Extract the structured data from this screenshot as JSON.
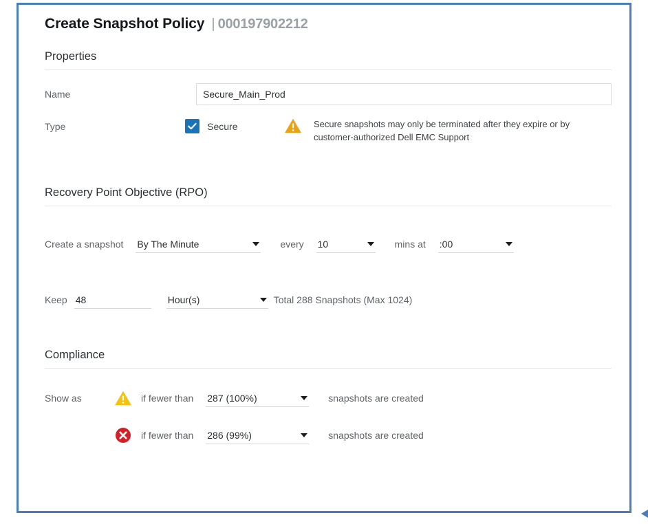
{
  "header": {
    "title": "Create Snapshot Policy",
    "separator": "|",
    "array_id": "000197902212"
  },
  "properties": {
    "section_title": "Properties",
    "name_label": "Name",
    "name_value": "Secure_Main_Prod",
    "name_placeholder": "",
    "type_label": "Type",
    "secure_checkbox_label": "Secure",
    "secure_checked": true,
    "warning_icon": "warning-triangle-icon",
    "warning_text": "Secure snapshots may only be terminated after they expire or by customer-authorized Dell EMC Support"
  },
  "rpo": {
    "section_title": "Recovery Point Objective (RPO)",
    "create_label": "Create a snapshot",
    "frequency_value": "By The Minute",
    "every_label": "every",
    "interval_value": "10",
    "mins_at_label": "mins at",
    "offset_value": ":00",
    "keep_label": "Keep",
    "keep_value": "48",
    "keep_unit_value": "Hour(s)",
    "total_text": "Total 288 Snapshots (Max 1024)"
  },
  "compliance": {
    "section_title": "Compliance",
    "show_as_label": "Show as",
    "rows": [
      {
        "icon": "warning-triangle-icon",
        "if_fewer_than_label": "if fewer than",
        "threshold_value": "287 (100%)",
        "suffix_label": "snapshots are created"
      },
      {
        "icon": "error-circle-icon",
        "if_fewer_than_label": "if fewer than",
        "threshold_value": "286 (99%)",
        "suffix_label": "snapshots are created"
      }
    ]
  },
  "colors": {
    "panel_border": "#4a7ebb",
    "checkbox_blue": "#1a73b7",
    "warning_amber": "#e8a317",
    "warning_gold": "#f1c40f",
    "error_red": "#d32027",
    "muted_text": "#5f6368"
  }
}
